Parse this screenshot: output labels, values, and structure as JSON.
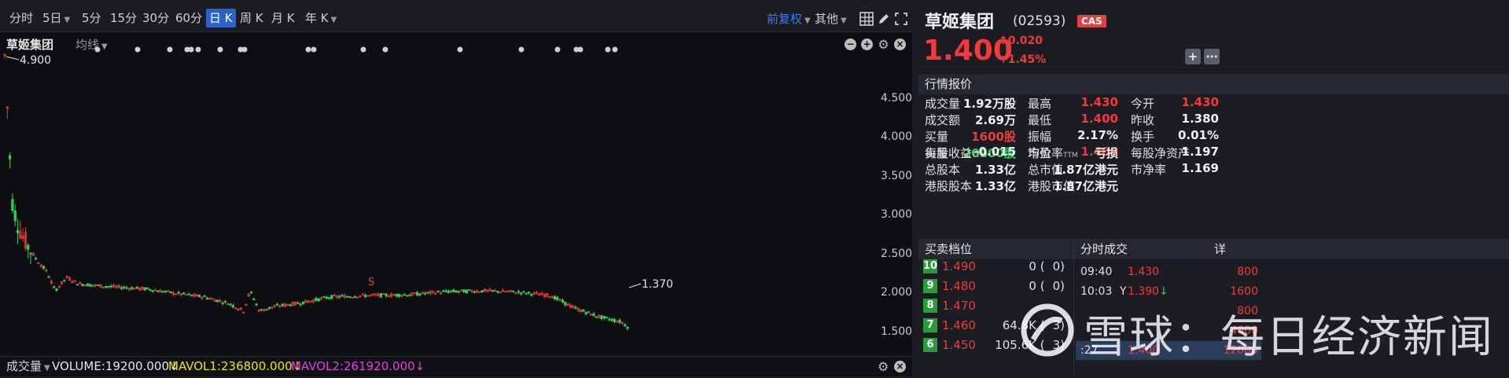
{
  "toolbar": {
    "periods": [
      {
        "label": "分时",
        "caret": false,
        "active": false
      },
      {
        "label": "5日",
        "caret": true,
        "active": false
      },
      {
        "label": "5分",
        "caret": false,
        "active": false
      },
      {
        "label": "15分",
        "caret": false,
        "active": false
      },
      {
        "label": "30分",
        "caret": false,
        "active": false
      },
      {
        "label": "60分",
        "caret": false,
        "active": false
      },
      {
        "label": "日 K",
        "caret": false,
        "active": true
      },
      {
        "label": "周 K",
        "caret": false,
        "active": false
      },
      {
        "label": "月 K",
        "caret": false,
        "active": false
      },
      {
        "label": "年 K",
        "caret": true,
        "active": false
      }
    ],
    "adjust": "前复权",
    "other": "其他",
    "colors": {
      "active": "#2a62c9",
      "adjust": "#3d7cf0"
    }
  },
  "chart": {
    "title": "草姬集团",
    "indicator": "均线",
    "max_label": "4.900",
    "min_label": "1.370",
    "marker": "S",
    "y_ticks": [
      "4.500",
      "4.000",
      "3.500",
      "3.000",
      "2.500",
      "2.000",
      "1.500"
    ]
  },
  "bottom": {
    "volume_select": "成交量",
    "volume": "VOLUME:19200.000",
    "mavol1": "MAVOL1:236800.000",
    "mavol2": "MAVOL2:261920.000",
    "colors": {
      "volume": "#e6e6e6",
      "mavol1": "#f2e300",
      "mavol2": "#e040e0"
    }
  },
  "quote": {
    "name": "草姬集团",
    "code": "(02593)",
    "tag": "CAS",
    "price": "1.400",
    "change": "0.020",
    "change_pct": "+1.45%"
  },
  "market": {
    "section_title": "行情报价",
    "rows": [
      [
        {
          "l": "成交量",
          "v": "1.92万股",
          "c": ""
        },
        {
          "l": "最高",
          "v": "1.430",
          "c": "red"
        },
        {
          "l": "今开",
          "v": "1.430",
          "c": "red"
        }
      ],
      [
        {
          "l": "成交额",
          "v": "2.69万",
          "c": ""
        },
        {
          "l": "最低",
          "v": "1.400",
          "c": "red"
        },
        {
          "l": "昨收",
          "v": "1.380",
          "c": ""
        }
      ],
      [
        {
          "l": "买量",
          "v": "1600股",
          "c": "red"
        },
        {
          "l": "振幅",
          "v": "2.17%",
          "c": ""
        },
        {
          "l": "换手",
          "v": "0.01%",
          "c": ""
        }
      ],
      [
        {
          "l": "卖量",
          "v": "20000股",
          "c": "green"
        },
        {
          "l": "均价",
          "v": "1.400",
          "c": "red"
        },
        {
          "l": "",
          "v": "",
          "c": ""
        }
      ]
    ],
    "rows2": [
      [
        {
          "l": "每股收益",
          "ttm": "TTM",
          "v": "-0.015"
        },
        {
          "l": "市盈率",
          "ttm": "TTM",
          "v": "亏损"
        },
        {
          "l": "每股净资产",
          "ttm": "",
          "v": "1.197"
        }
      ],
      [
        {
          "l": "总股本",
          "ttm": "",
          "v": "1.33亿"
        },
        {
          "l": "总市值",
          "ttm": "",
          "v": "1.87亿港元"
        },
        {
          "l": "市净率",
          "ttm": "",
          "v": "1.169"
        }
      ],
      [
        {
          "l": "港股股本",
          "ttm": "",
          "v": "1.33亿"
        },
        {
          "l": "港股市值",
          "ttm": "",
          "v": "1.87亿港元"
        },
        {
          "l": "",
          "ttm": "",
          "v": ""
        }
      ]
    ]
  },
  "orderbook": {
    "title": "买卖档位",
    "levels": [
      {
        "n": "10",
        "price": "1.490",
        "vol": "0 (",
        "cnt": "0)"
      },
      {
        "n": "9",
        "price": "1.480",
        "vol": "0 (",
        "cnt": "0)"
      },
      {
        "n": "8",
        "price": "1.470",
        "vol": "",
        "cnt": ""
      },
      {
        "n": "7",
        "price": "1.460",
        "vol": "64.8K (",
        "cnt": "3)"
      },
      {
        "n": "6",
        "price": "1.450",
        "vol": "105.6K (",
        "cnt": "3)"
      }
    ]
  },
  "trades": {
    "title": "分时成交",
    "detail": "详",
    "rows": [
      {
        "time": "09:40",
        "flag": "",
        "price": "1.430",
        "arrow": "",
        "vol": "800"
      },
      {
        "time": "10:03",
        "flag": "Y",
        "price": "1.390",
        "arrow": "↓",
        "vol": "1600"
      },
      {
        "time": "",
        "flag": "",
        "price": "",
        "arrow": "",
        "vol": "800"
      },
      {
        "time": "",
        "flag": "",
        "price": "",
        "arrow": "",
        "vol": "4000"
      },
      {
        "time": ":27",
        "flag": "",
        "price": "1.400",
        "arrow": "",
        "vol": "12000"
      }
    ]
  },
  "watermark": {
    "text": "雪球：每日经济新闻"
  },
  "colors": {
    "up": "#ef3b3b",
    "down": "#30d158",
    "bg": "#0d0e11"
  }
}
